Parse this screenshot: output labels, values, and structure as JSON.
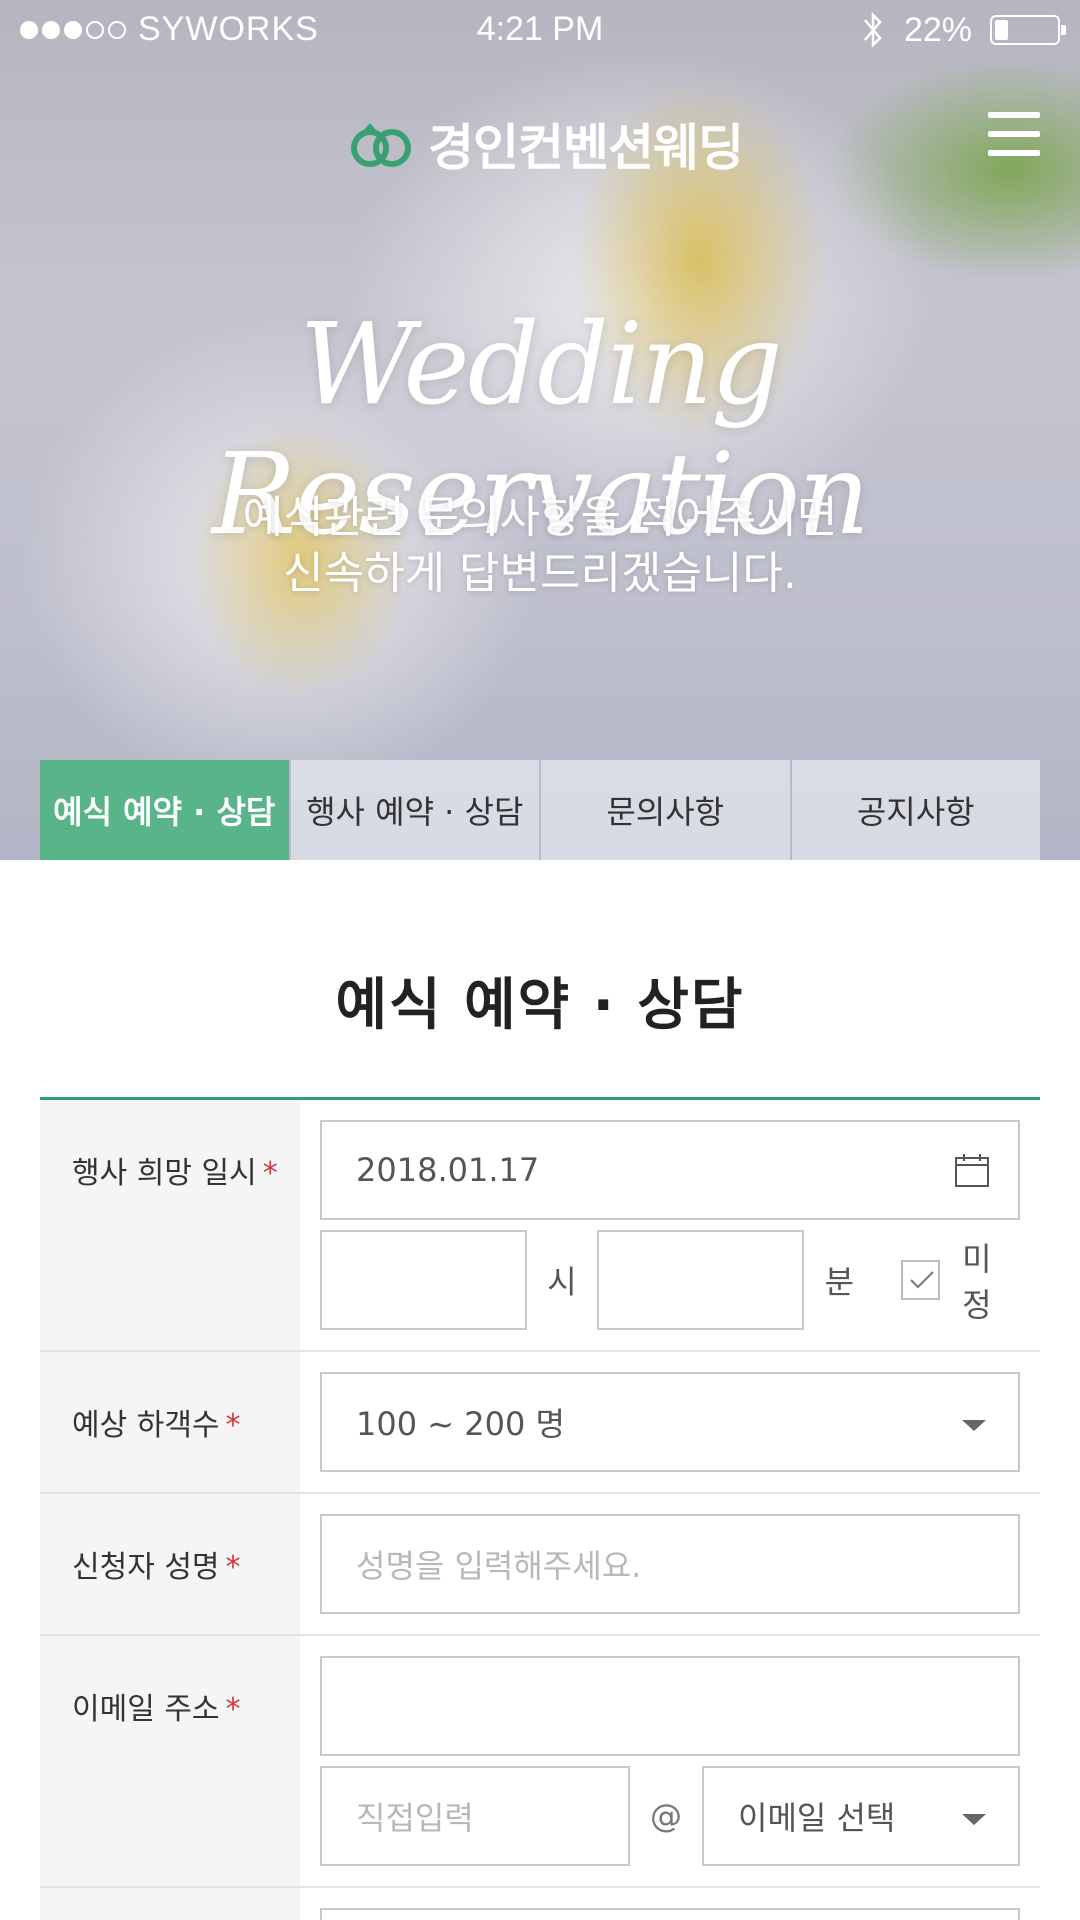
{
  "status_bar": {
    "carrier": "SYWORKS",
    "time": "4:21 PM",
    "battery": "22%",
    "battery_level": 0.22
  },
  "header": {
    "logo_text": "경인컨벤션웨딩",
    "logo_color": "#3aa072"
  },
  "hero": {
    "title": "Wedding Reservation",
    "subtitle_line1": "예식관련 문의사항을 적어주시면",
    "subtitle_line2": "신속하게 답변드리겠습니다."
  },
  "tabs": [
    {
      "label": "예식 예약 · 상담",
      "active": true
    },
    {
      "label": "행사 예약 · 상담",
      "active": false
    },
    {
      "label": "문의사항",
      "active": false
    },
    {
      "label": "공지사항",
      "active": false
    }
  ],
  "section_title": "예식 예약 · 상담",
  "colors": {
    "accent": "#5ab489",
    "accent_line": "#2f9e6c",
    "required": "#d23a3a"
  },
  "form": {
    "required_mark": "*",
    "date_row": {
      "label": "행사 희망 일시",
      "date_value": "2018.01.17",
      "hour_unit": "시",
      "minute_unit": "분",
      "undecided_label": "미정",
      "undecided_checked": true
    },
    "guests_row": {
      "label": "예상 하객수",
      "selected": "100 ~ 200 명"
    },
    "name_row": {
      "label": "신청자 성명",
      "placeholder": "성명을 입력해주세요."
    },
    "email_row": {
      "label": "이메일 주소",
      "domain_placeholder": "직접입력",
      "at_sign": "@",
      "domain_select": "이메일 선택"
    }
  }
}
